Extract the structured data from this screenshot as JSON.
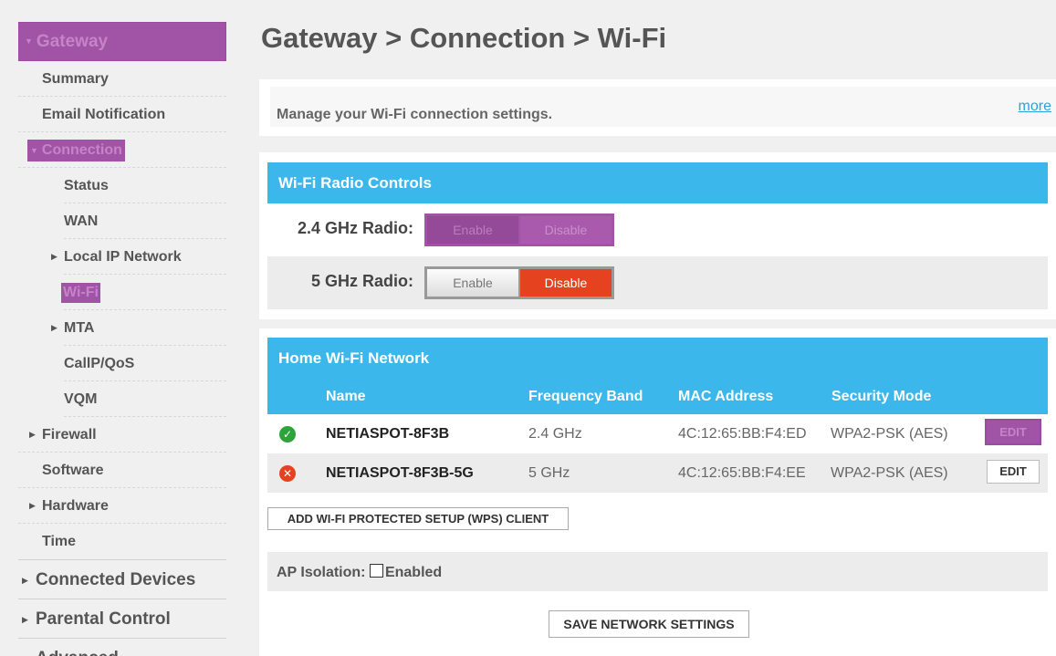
{
  "sidebar": {
    "gateway": "Gateway",
    "items": [
      {
        "label": "Summary"
      },
      {
        "label": "Email Notification"
      }
    ],
    "connection": "Connection",
    "connection_items": [
      {
        "label": "Status"
      },
      {
        "label": "WAN"
      },
      {
        "label": "Local IP Network"
      },
      {
        "label": "Wi-Fi"
      },
      {
        "label": "MTA"
      },
      {
        "label": "CallP/QoS"
      },
      {
        "label": "VQM"
      }
    ],
    "lower_items": [
      {
        "label": "Firewall"
      },
      {
        "label": "Software"
      },
      {
        "label": "Hardware"
      },
      {
        "label": "Time"
      }
    ],
    "sections": [
      {
        "label": "Connected Devices"
      },
      {
        "label": "Parental Control"
      },
      {
        "label": "Advanced"
      }
    ]
  },
  "page": {
    "title": "Gateway > Connection > Wi-Fi",
    "intro": "Manage your Wi-Fi connection settings.",
    "more": "more"
  },
  "radio_controls": {
    "title": "Wi-Fi Radio Controls",
    "rows": [
      {
        "label": "2.4 GHz Radio:",
        "enable": "Enable",
        "disable": "Disable"
      },
      {
        "label": "5 GHz Radio:",
        "enable": "Enable",
        "disable": "Disable"
      }
    ]
  },
  "home_network": {
    "title": "Home Wi-Fi Network",
    "columns": [
      "Name",
      "Frequency Band",
      "MAC Address",
      "Security Mode"
    ],
    "rows": [
      {
        "name": "NETIASPOT-8F3B",
        "band": "2.4 GHz",
        "mac": "4C:12:65:BB:F4:ED",
        "security": "WPA2-PSK (AES)",
        "edit": "EDIT",
        "status": "ok"
      },
      {
        "name": "NETIASPOT-8F3B-5G",
        "band": "5 GHz",
        "mac": "4C:12:65:BB:F4:EE",
        "security": "WPA2-PSK (AES)",
        "edit": "EDIT",
        "status": "error"
      }
    ],
    "wps_button": "ADD WI-FI PROTECTED SETUP (WPS) CLIENT",
    "ap_isolation_label": "AP Isolation:",
    "ap_isolation_option": "Enabled",
    "save_button": "SAVE NETWORK SETTINGS"
  },
  "icons": {
    "ok": "check-circle-icon",
    "error": "x-circle-icon"
  },
  "colors": {
    "accent_blue": "#3bb7ec",
    "highlight_purple": "#a154a5",
    "disable_red": "#e5431f",
    "ok_green": "#2da43a"
  }
}
